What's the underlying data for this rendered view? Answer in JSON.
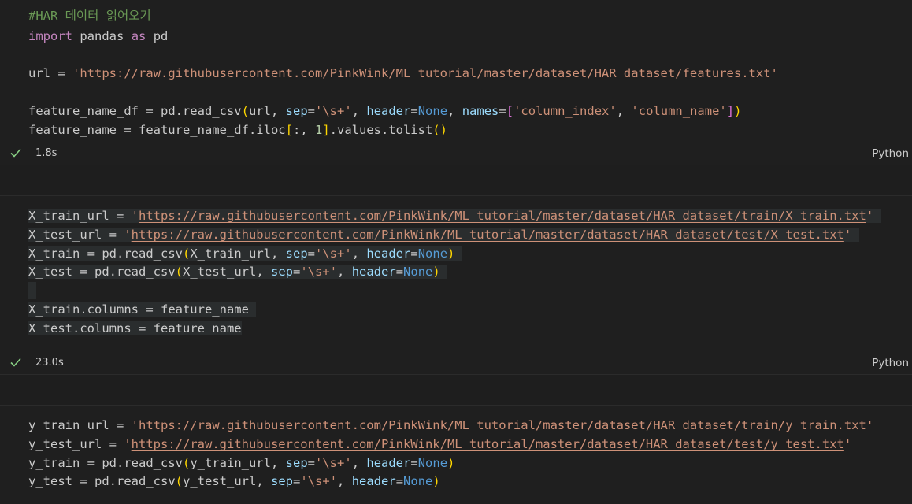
{
  "cells": [
    {
      "tokens": {
        "comment": "#HAR 데이터 읽어오기",
        "kw_import": "import",
        "mod_pandas": "pandas",
        "kw_as": "as",
        "alias_pd": "pd",
        "url_var": "url",
        "url_value": "https://raw.githubusercontent.com/PinkWink/ML_tutorial/master/dataset/HAR_dataset/features.txt",
        "df_var": "feature_name_df",
        "pd_read": "pd.read_csv",
        "arg_url": "url",
        "sep_kw": "sep",
        "sep_val": "\\s+",
        "header_kw": "header",
        "none_val": "None",
        "names_kw": "names",
        "name1": "column_index",
        "name2": "column_name",
        "feat_var": "feature_name",
        "iloc_expr": "feature_name_df.iloc",
        "slice": ":, ",
        "idx": "1",
        "tolist": ".values.tolist"
      },
      "status": {
        "time": "1.8s",
        "language": "Python"
      }
    },
    {
      "tokens": {
        "xtrain_url_var": "X_train_url",
        "xtrain_url": "https://raw.githubusercontent.com/PinkWink/ML_tutorial/master/dataset/HAR_dataset/train/X_train.txt",
        "xtest_url_var": "X_test_url",
        "xtest_url": "https://raw.githubusercontent.com/PinkWink/ML_tutorial/master/dataset/HAR_dataset/test/X_test.txt",
        "xtrain_var": "X_train",
        "xtest_var": "X_test",
        "pd_read": "pd.read_csv",
        "sep_kw": "sep",
        "sep_val": "\\s+",
        "header_kw": "header",
        "none_val": "None",
        "xtrain_cols": "X_train.columns",
        "xtest_cols": "X_test.columns",
        "feat": "feature_name"
      },
      "status": {
        "time": "23.0s",
        "language": "Python"
      }
    },
    {
      "tokens": {
        "ytrain_url_var": "y_train_url",
        "ytrain_url": "https://raw.githubusercontent.com/PinkWink/ML_tutorial/master/dataset/HAR_dataset/train/y_train.txt",
        "ytest_url_var": "y_test_url",
        "ytest_url": "https://raw.githubusercontent.com/PinkWink/ML_tutorial/master/dataset/HAR_dataset/test/y_test.txt",
        "ytrain_var": "y_train",
        "ytest_var": "y_test",
        "pd_read": "pd.read_csv",
        "sep_kw": "sep",
        "sep_val": "\\s+",
        "header_kw": "header",
        "none_val": "None"
      }
    }
  ],
  "colors": {
    "background": "#1f1f1f",
    "comment": "#6a9955",
    "keyword": "#c586c0",
    "string": "#ce9178",
    "parameter": "#9cdcfe",
    "constant": "#569cd6",
    "number": "#b5cea8",
    "success_check": "#89d185"
  },
  "icons": {
    "status_check": "check-icon"
  }
}
